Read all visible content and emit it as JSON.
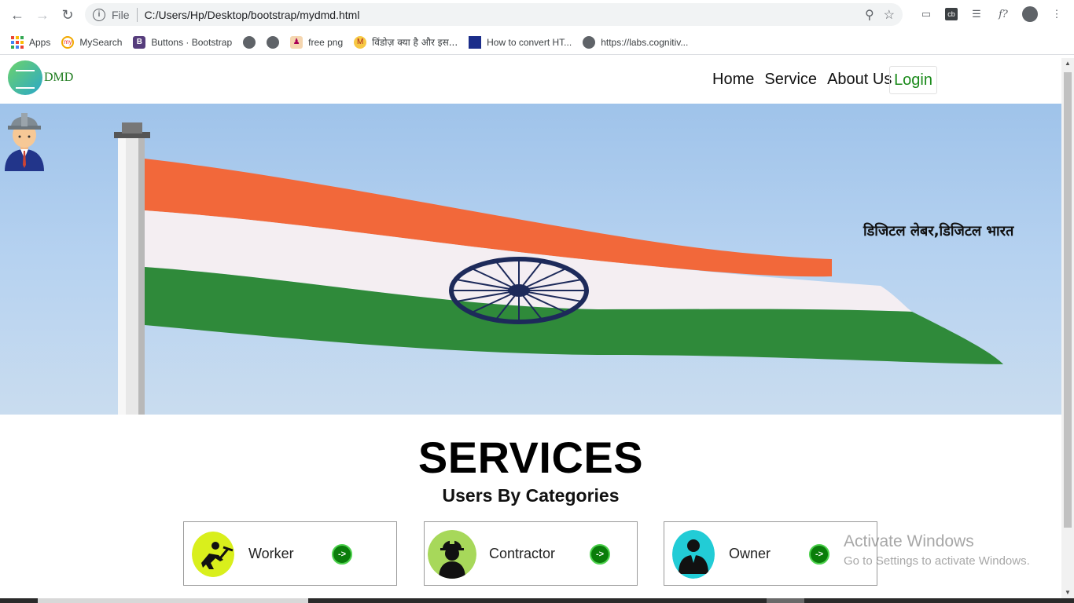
{
  "browser": {
    "url_scheme": "File",
    "url": "C:/Users/Hp/Desktop/bootstrap/mydmd.html",
    "bookmarks": [
      {
        "label": "Apps",
        "icon": "apps-grid-icon"
      },
      {
        "label": "MySearch",
        "icon": "mysearch-icon"
      },
      {
        "label": "Buttons · Bootstrap",
        "icon": "bootstrap-icon"
      },
      {
        "label": "",
        "icon": "globe-icon"
      },
      {
        "label": "",
        "icon": "globe-icon"
      },
      {
        "label": "free png",
        "icon": "freepng-icon"
      },
      {
        "label": "विंडोज़ क्या है और इस...",
        "icon": "hindi-site-icon"
      },
      {
        "label": "How to convert HT...",
        "icon": "flag-icon"
      },
      {
        "label": "https://labs.cognitiv...",
        "icon": "globe-icon"
      }
    ]
  },
  "site": {
    "logo_text": "DMD",
    "nav": {
      "home": "Home",
      "service": "Service",
      "about": "About Us",
      "login": "Login"
    },
    "hero": {
      "tagline": "डिजिटल लेबर,डिजिटल भारत"
    },
    "services": {
      "title": "SERVICES",
      "subtitle": "Users By Categories",
      "categories": [
        {
          "label": "Worker",
          "go": "->",
          "icon": "worker-icon"
        },
        {
          "label": "Contractor",
          "go": "->",
          "icon": "contractor-icon"
        },
        {
          "label": "Owner",
          "go": "->",
          "icon": "owner-icon"
        }
      ]
    }
  },
  "overlay": {
    "activate_title": "Activate Windows",
    "activate_sub": "Go to Settings to activate Windows."
  },
  "colors": {
    "brand_green": "#1a8a1a",
    "saffron": "#f2683a",
    "india_green": "#2f8a3a",
    "chakra_navy": "#1d2a5a"
  }
}
